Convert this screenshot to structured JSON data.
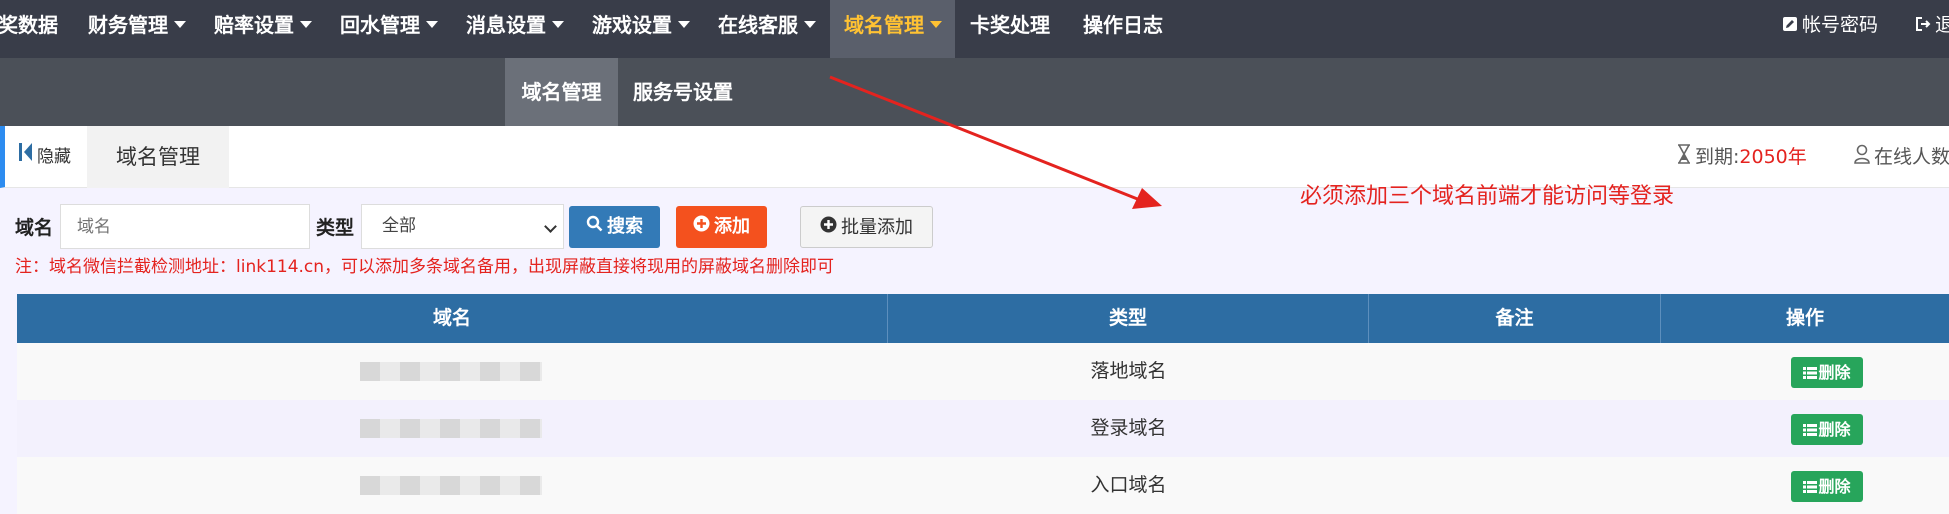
{
  "topnav": {
    "items": [
      {
        "label": "奖数据"
      },
      {
        "label": "财务管理"
      },
      {
        "label": "赔率设置"
      },
      {
        "label": "回水管理"
      },
      {
        "label": "消息设置"
      },
      {
        "label": "游戏设置"
      },
      {
        "label": "在线客服"
      },
      {
        "label": "域名管理"
      },
      {
        "label": "卡奖处理"
      },
      {
        "label": "操作日志"
      }
    ],
    "account": "帐号密码",
    "logout": "退"
  },
  "subnav": {
    "items": [
      {
        "label": "域名管理"
      },
      {
        "label": "服务号设置"
      }
    ]
  },
  "tabbar": {
    "hide_label": "隐藏",
    "tab_label": "域名管理",
    "expire_label": "到期:",
    "expire_value": "2050年",
    "online_label": "在线人数"
  },
  "search": {
    "domain_label": "域名",
    "domain_placeholder": "域名",
    "type_label": "类型",
    "type_selected": "全部",
    "search_button": "搜索",
    "add_button": "添加",
    "batch_add_button": "批量添加"
  },
  "note": "注：域名微信拦截检测地址：link114.cn，可以添加多条域名备用，出现屏蔽直接将现用的屏蔽域名删除即可",
  "annotation": "必须添加三个域名前端才能访问等登录",
  "table": {
    "headers": [
      "域名",
      "类型",
      "备注",
      "操作"
    ],
    "rows": [
      {
        "type": "落地域名",
        "action": "删除"
      },
      {
        "type": "登录域名",
        "action": "删除"
      },
      {
        "type": "入口域名",
        "action": "删除"
      }
    ]
  },
  "colors": {
    "nav_bg": "#393d49",
    "active_text": "#ffc233",
    "table_header": "#2d6da3",
    "delete_button": "#27a55b",
    "alert_red": "#e4231f"
  }
}
